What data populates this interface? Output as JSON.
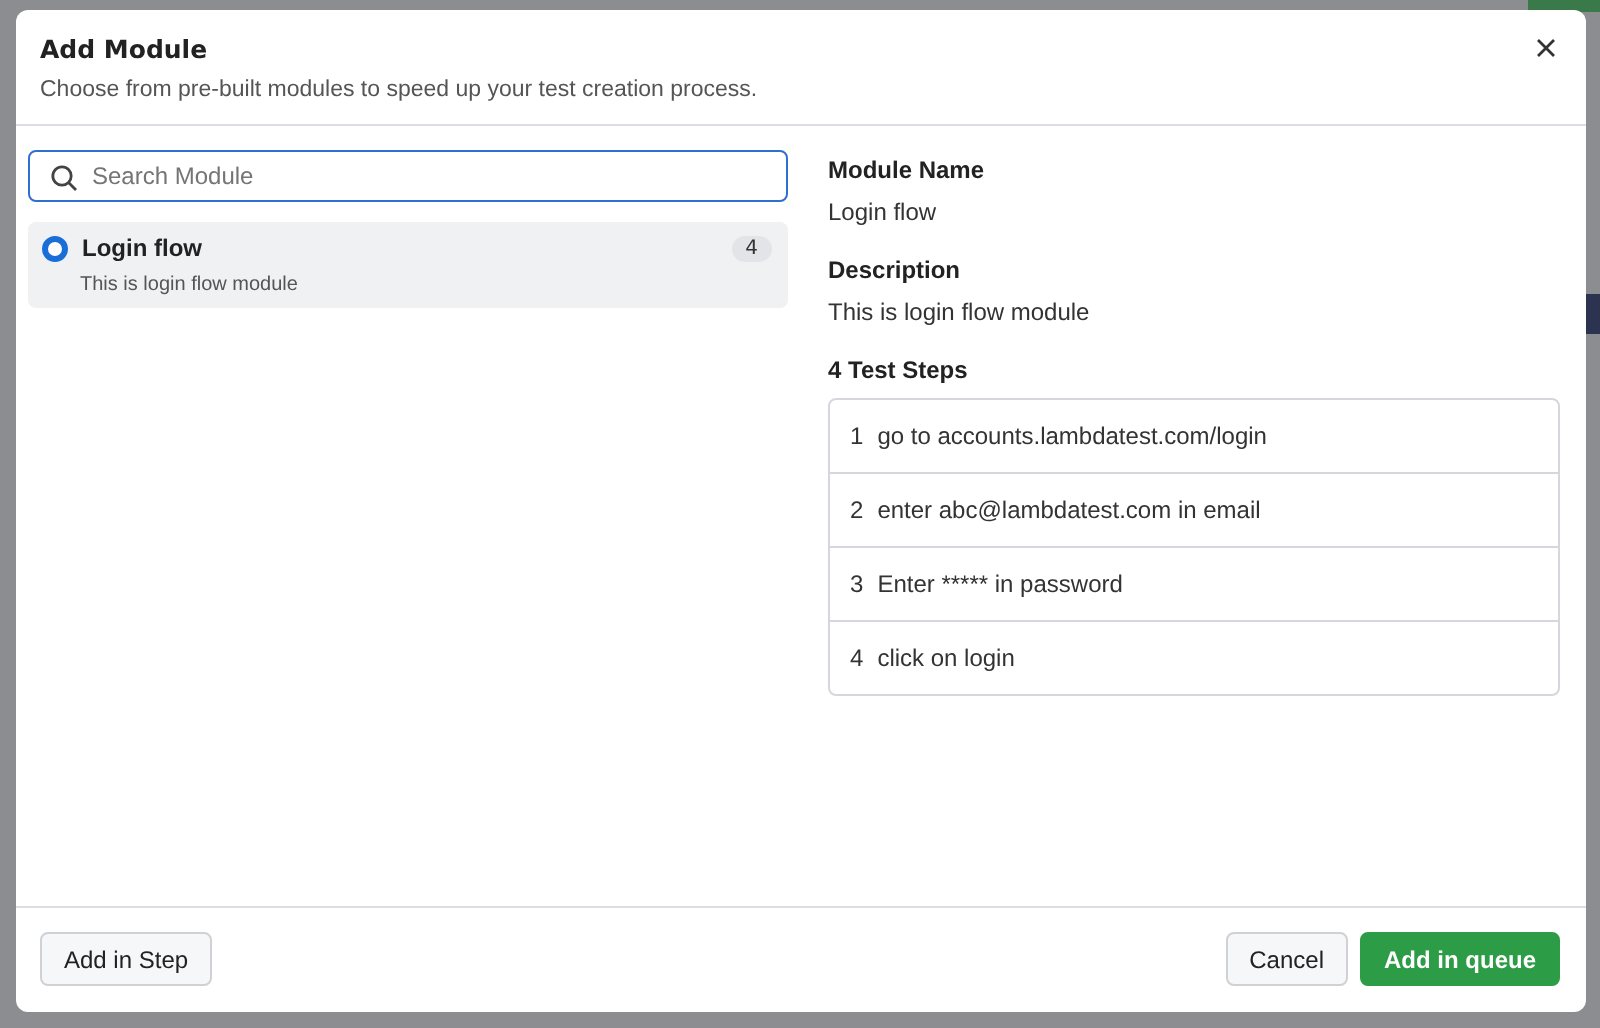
{
  "dialog": {
    "title": "Add Module",
    "subtitle": "Choose from pre-built modules to speed up your test creation process."
  },
  "search": {
    "placeholder": "Search Module"
  },
  "modules": [
    {
      "name": "Login flow",
      "description": "This is login flow module",
      "count": "4",
      "selected": true
    }
  ],
  "details": {
    "name_label": "Module Name",
    "name": "Login flow",
    "description_label": "Description",
    "description": "This is login flow module",
    "steps_label": "4 Test Steps",
    "steps": [
      {
        "number": "1",
        "text": "go to accounts.lambdatest.com/login"
      },
      {
        "number": "2",
        "text": "enter abc@lambdatest.com in email"
      },
      {
        "number": "3",
        "text": "Enter ***** in password"
      },
      {
        "number": "4",
        "text": "click on login"
      }
    ]
  },
  "footer": {
    "left_button": "Add in Step",
    "cancel_button": "Cancel",
    "primary_button": "Add in queue"
  }
}
